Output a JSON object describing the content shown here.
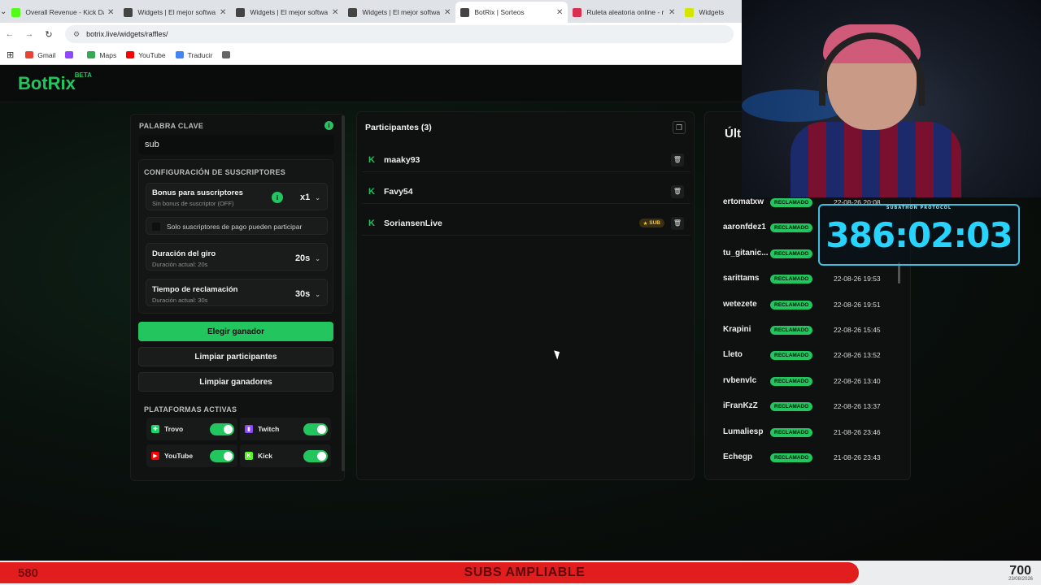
{
  "browser": {
    "tabs": [
      {
        "title": "Overall Revenue - Kick Da",
        "color": "#53fc18"
      },
      {
        "title": "Widgets | El mejor softwa",
        "color": "#444444"
      },
      {
        "title": "Widgets | El mejor softwa",
        "color": "#444444"
      },
      {
        "title": "Widgets | El mejor softwa",
        "color": "#444444"
      },
      {
        "title": "BotRix | Sorteos",
        "color": "#444444"
      },
      {
        "title": "Ruleta aleatoria online - r",
        "color": "#d9304f"
      },
      {
        "title": "Widgets",
        "color": "#d4e600"
      }
    ],
    "url": "botrix.live/widgets/raffles/",
    "bookmarks": [
      {
        "label": "Gmail",
        "color": "#ea4335"
      },
      {
        "label": "",
        "color": "#9146ff"
      },
      {
        "label": "Maps",
        "color": "#34a853"
      },
      {
        "label": "YouTube",
        "color": "#ff0000"
      },
      {
        "label": "Traducir",
        "color": "#4285f4"
      },
      {
        "label": "",
        "color": "#666666"
      }
    ]
  },
  "brand": {
    "name": "BotRix",
    "tag": "BETA"
  },
  "keyword": {
    "label": "PALABRA CLAVE",
    "value": "sub"
  },
  "subscribers": {
    "label": "CONFIGURACIÓN DE SUSCRIPTORES",
    "bonus_title": "Bonus para suscriptores",
    "bonus_sub": "Sin bonus de suscriptor (OFF)",
    "bonus_value": "x1",
    "paid_only": "Solo suscriptores de pago pueden participar",
    "spin_title": "Duración del giro",
    "spin_sub": "Duración actual: 20s",
    "spin_value": "20s",
    "claim_title": "Tiempo de reclamación",
    "claim_sub": "Duración actual: 30s",
    "claim_value": "30s"
  },
  "actions": {
    "pick_winner": "Elegir ganador",
    "clear_participants": "Limpiar participantes",
    "clear_winners": "Limpiar ganadores"
  },
  "platforms": {
    "label": "PLATAFORMAS ACTIVAS",
    "items": [
      {
        "name": "Trovo",
        "color": "#19d66b"
      },
      {
        "name": "Twitch",
        "color": "#9146ff"
      },
      {
        "name": "YouTube",
        "color": "#ff0000"
      },
      {
        "name": "Kick",
        "color": "#53fc18"
      }
    ]
  },
  "participants": {
    "title": "Participantes (3)",
    "items": [
      {
        "name": "maaky93"
      },
      {
        "name": "Favy54"
      },
      {
        "name": "SoriansenLive",
        "badge": "SUB"
      }
    ]
  },
  "winners": {
    "title": "Últ",
    "claimed_label": "RECLAMADO",
    "items": [
      {
        "name": "ertomatxw",
        "date": "22-08-26 20:08"
      },
      {
        "name": "aaronfdez1",
        "date": ""
      },
      {
        "name": "tu_gitanic...",
        "date": ""
      },
      {
        "name": "sarittams",
        "date": "22-08-26 19:53"
      },
      {
        "name": "wetezete",
        "date": "22-08-26 19:51"
      },
      {
        "name": "Krapini",
        "date": "22-08-26 15:45"
      },
      {
        "name": "Lleto",
        "date": "22-08-26 13:52"
      },
      {
        "name": "rvbenvlc",
        "date": "22-08-26 13:40"
      },
      {
        "name": "iFranKzZ",
        "date": "22-08-26 13:37"
      },
      {
        "name": "Lumaliesp",
        "date": "21-08-26 23:46"
      },
      {
        "name": "Echegp",
        "date": "21-08-26 23:43"
      }
    ]
  },
  "overlay": {
    "timer": "386:02:03",
    "timer_label": "SUBATHON PROTOCOL",
    "left_count": "580",
    "banner": "SUBS AMPLIABLE",
    "right_count": "700",
    "date": "23/08/2026"
  }
}
